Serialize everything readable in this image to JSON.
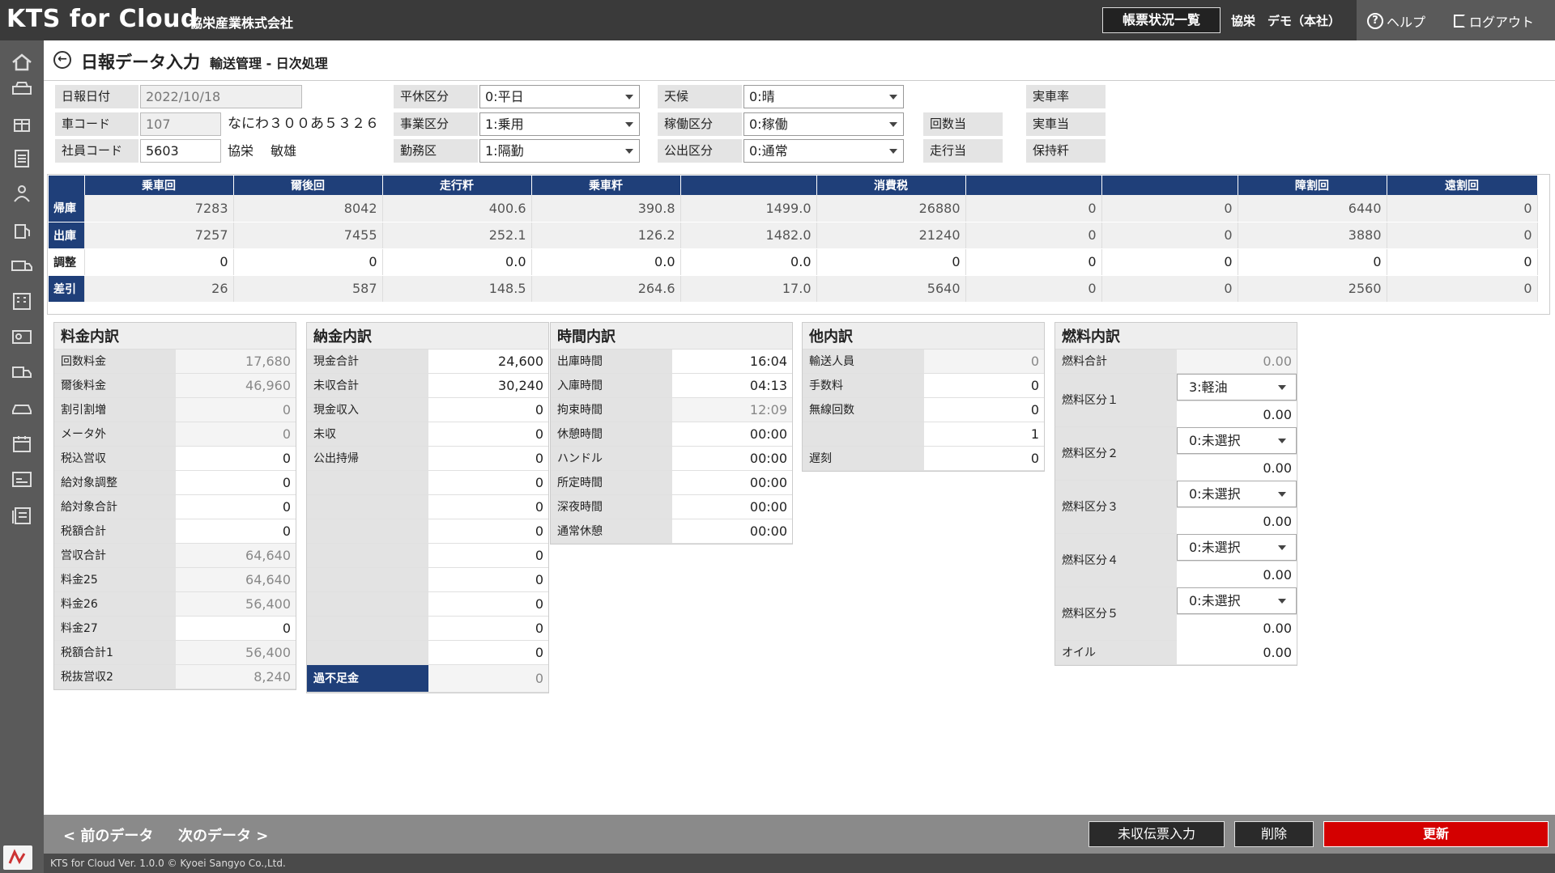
{
  "header": {
    "app_title": "KTS for Cloud",
    "company": "協栄産業株式会社",
    "report_button": "帳票状況一覧",
    "user": "協栄　デモ（本社）",
    "help": "ヘルプ",
    "logout": "ログアウト"
  },
  "page": {
    "title": "日報データ入力",
    "subtitle": "輸送管理 - 日次処理"
  },
  "form": {
    "date_label": "日報日付",
    "date_value": "2022/10/18",
    "car_label": "車コード",
    "car_value": "107",
    "car_name": "なにわ３００あ５３２６",
    "emp_label": "社員コード",
    "emp_value": "5603",
    "emp_name": "協栄　 敏雄",
    "holiday_label": "平休区分",
    "holiday_value": "0:平日",
    "business_label": "事業区分",
    "business_value": "1:乗用",
    "shift_label": "勤務区",
    "shift_value": "1:隔勤",
    "weather_label": "天候",
    "weather_value": "0:晴",
    "operation_label": "稼働区分",
    "operation_value": "0:稼働",
    "public_label": "公出区分",
    "public_value": "0:通常",
    "per_count_label": "回数当",
    "per_run_label": "走行当",
    "real_rate_label": "実車率",
    "real_per_label": "実車当",
    "keep_label": "保持粁"
  },
  "summary": {
    "headers": [
      "乗車回",
      "爾後回",
      "走行粁",
      "乗車粁",
      "",
      "消費税",
      "",
      "",
      "障割回",
      "遠割回"
    ],
    "rows": [
      {
        "label": "帰庫",
        "values": [
          "7283",
          "8042",
          "400.6",
          "390.8",
          "1499.0",
          "26880",
          "0",
          "0",
          "6440",
          "0"
        ]
      },
      {
        "label": "出庫",
        "values": [
          "7257",
          "7455",
          "252.1",
          "126.2",
          "1482.0",
          "21240",
          "0",
          "0",
          "3880",
          "0"
        ]
      },
      {
        "label": "調整",
        "values": [
          "0",
          "0",
          "0.0",
          "0.0",
          "0.0",
          "0",
          "0",
          "0",
          "0",
          "0"
        ]
      },
      {
        "label": "差引",
        "values": [
          "26",
          "587",
          "148.5",
          "264.6",
          "17.0",
          "5640",
          "0",
          "0",
          "2560",
          "0"
        ]
      }
    ]
  },
  "fare": {
    "title": "料金内訳",
    "rows": [
      {
        "label": "回数料金",
        "value": "17,680"
      },
      {
        "label": "爾後料金",
        "value": "46,960"
      },
      {
        "label": "割引割増",
        "value": "0"
      },
      {
        "label": "メータ外",
        "value": "0"
      },
      {
        "label": "税込営収",
        "value": "0"
      },
      {
        "label": "給対象調整",
        "value": "0"
      },
      {
        "label": "給対象合計",
        "value": "0"
      },
      {
        "label": "税額合計",
        "value": "0"
      },
      {
        "label": "営収合計",
        "value": "64,640"
      },
      {
        "label": "料金25",
        "value": "64,640"
      },
      {
        "label": "料金26",
        "value": "56,400"
      },
      {
        "label": "料金27",
        "value": "0"
      },
      {
        "label": "税額合計1",
        "value": "56,400"
      },
      {
        "label": "税抜営収2",
        "value": "8,240"
      }
    ]
  },
  "payment": {
    "title": "納金内訳",
    "rows": [
      {
        "label": "現金合計",
        "value": "24,600"
      },
      {
        "label": "未収合計",
        "value": "30,240"
      },
      {
        "label": "現金収入",
        "value": "0"
      },
      {
        "label": "未収",
        "value": "0"
      },
      {
        "label": "公出持帰",
        "value": "0"
      },
      {
        "label": "",
        "value": "0"
      },
      {
        "label": "",
        "value": "0"
      },
      {
        "label": "",
        "value": "0"
      },
      {
        "label": "",
        "value": "0"
      },
      {
        "label": "",
        "value": "0"
      },
      {
        "label": "",
        "value": "0"
      },
      {
        "label": "",
        "value": "0"
      },
      {
        "label": "",
        "value": "0"
      }
    ],
    "shortage_label": "過不足金",
    "shortage_value": "0"
  },
  "time": {
    "title": "時間内訳",
    "rows": [
      {
        "label": "出庫時間",
        "value": "16:04"
      },
      {
        "label": "入庫時間",
        "value": "04:13"
      },
      {
        "label": "拘束時間",
        "value": "12:09"
      },
      {
        "label": "休憩時間",
        "value": "00:00"
      },
      {
        "label": "ハンドル",
        "value": "00:00"
      },
      {
        "label": "所定時間",
        "value": "00:00"
      },
      {
        "label": "深夜時間",
        "value": "00:00"
      },
      {
        "label": "通常休憩",
        "value": "00:00"
      }
    ]
  },
  "other": {
    "title": "他内訳",
    "rows": [
      {
        "label": "輸送人員",
        "value": "0"
      },
      {
        "label": "手数料",
        "value": "0"
      },
      {
        "label": "無線回数",
        "value": "0"
      },
      {
        "label": "",
        "value": "1"
      },
      {
        "label": "遅刻",
        "value": "0"
      }
    ]
  },
  "fuel": {
    "title": "燃料内訳",
    "total_label": "燃料合計",
    "total_value": "0.00",
    "rows": [
      {
        "label": "燃料区分１",
        "select": "3:軽油",
        "value": "0.00"
      },
      {
        "label": "燃料区分２",
        "select": "0:未選択",
        "value": "0.00"
      },
      {
        "label": "燃料区分３",
        "select": "0:未選択",
        "value": "0.00"
      },
      {
        "label": "燃料区分４",
        "select": "0:未選択",
        "value": "0.00"
      },
      {
        "label": "燃料区分５",
        "select": "0:未選択",
        "value": "0.00"
      }
    ],
    "oil_label": "オイル",
    "oil_value": "0.00"
  },
  "footer": {
    "prev": "前のデータ",
    "next": "次のデータ",
    "unpaid_button": "未収伝票入力",
    "delete_button": "削除",
    "update_button": "更新",
    "copyright": "KTS for Cloud Ver. 1.0.0 © Kyoei Sangyo Co.,Ltd."
  },
  "colors": {
    "header_bg": "#3a3a3a",
    "table_header": "#1f3f79",
    "update_red": "#d40000"
  }
}
